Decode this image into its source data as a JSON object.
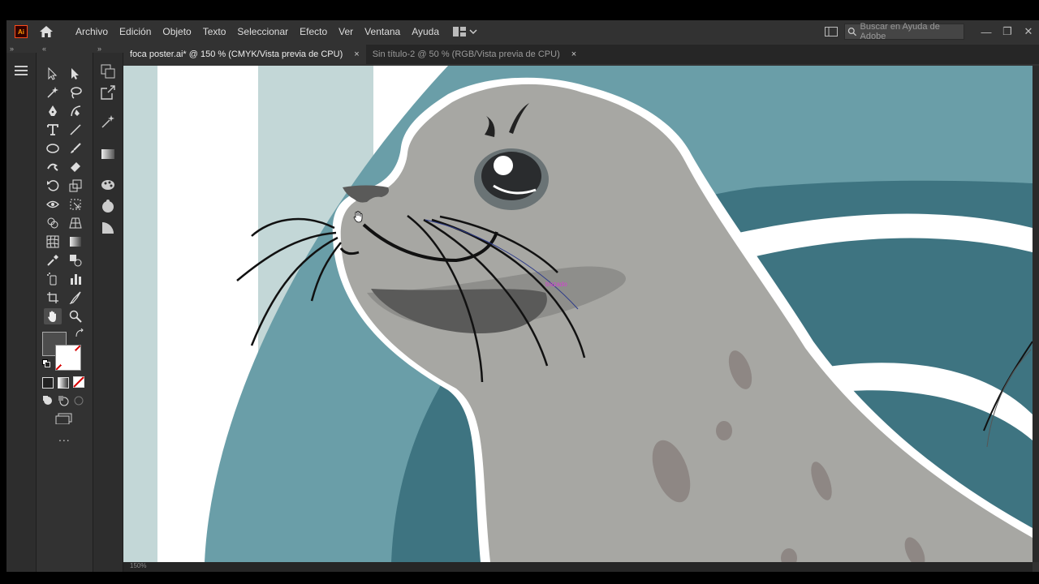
{
  "app": {
    "logo": "Ai",
    "home_icon": "home-icon"
  },
  "menubar": {
    "items": [
      "Archivo",
      "Edición",
      "Objeto",
      "Texto",
      "Seleccionar",
      "Efecto",
      "Ver",
      "Ventana",
      "Ayuda"
    ],
    "workspace_icon": "workspace-switcher-icon"
  },
  "search": {
    "placeholder": "Buscar en Ayuda de Adobe"
  },
  "tabs": [
    {
      "label": "foca poster.ai* @ 150 % (CMYK/Vista previa de CPU)",
      "active": true,
      "close": "×"
    },
    {
      "label": "Sin título-2 @ 50 % (RGB/Vista previa de CPU)",
      "active": false,
      "close": "×"
    }
  ],
  "tools": [
    "selection-tool",
    "direct-selection-tool",
    "magic-wand-tool",
    "lasso-tool",
    "pen-tool",
    "curvature-tool",
    "type-tool",
    "line-segment-tool",
    "ellipse-tool",
    "paintbrush-tool",
    "shaper-tool",
    "eraser-tool",
    "rotate-tool",
    "scale-tool",
    "width-tool",
    "free-transform-tool",
    "shape-builder-tool",
    "perspective-grid-tool",
    "mesh-tool",
    "gradient-tool",
    "eyedropper-tool",
    "blend-tool",
    "symbol-sprayer-tool",
    "column-graph-tool",
    "artboard-tool",
    "slice-tool",
    "hand-tool",
    "zoom-tool"
  ],
  "colors": {
    "fill": "#4d4d4d",
    "stroke": "none",
    "accent": "#ff4c1a",
    "canvas_teal_dark": "#3e7481",
    "canvas_teal_mid": "#6a9ea8",
    "canvas_teal_light": "#c3d7d7",
    "seal_gray": "#a7a7a3"
  },
  "canvas": {
    "hint_label": "trazado"
  },
  "statusbar": {
    "zoom": "150%"
  },
  "more": "..."
}
